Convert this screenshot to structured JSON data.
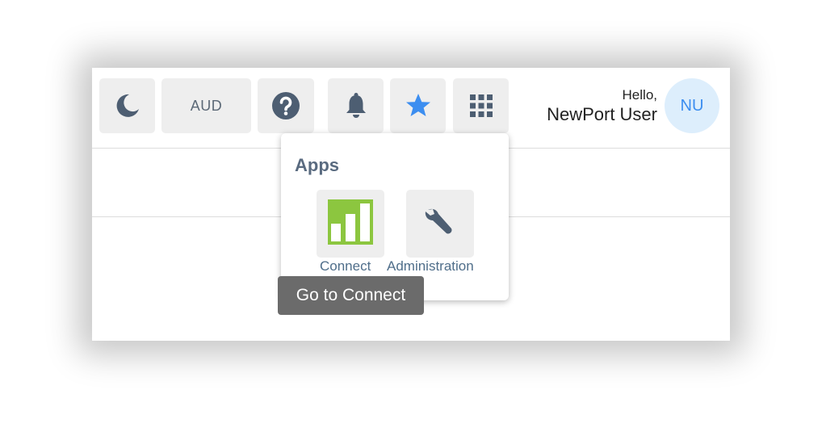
{
  "toolbar": {
    "currency_label": "AUD",
    "icons": {
      "theme": "moon-icon",
      "help": "question-circle-icon",
      "notifications": "bell-icon",
      "favorites": "star-icon",
      "apps": "grid-icon"
    }
  },
  "user": {
    "greeting": "Hello,",
    "name": "NewPort User",
    "initials": "NU"
  },
  "apps_menu": {
    "title": "Apps",
    "items": [
      {
        "label": "Connect",
        "icon": "bar-chart-icon"
      },
      {
        "label": "Administration",
        "icon": "wrench-icon"
      }
    ]
  },
  "tooltip": {
    "text": "Go to Connect"
  },
  "colors": {
    "button_bg": "#eeeeee",
    "icon_slate": "#4d5e72",
    "star_blue": "#3c8ef0",
    "avatar_bg": "#ddeefc",
    "connect_green": "#8cc63f",
    "tooltip_bg": "#6b6b6b"
  }
}
